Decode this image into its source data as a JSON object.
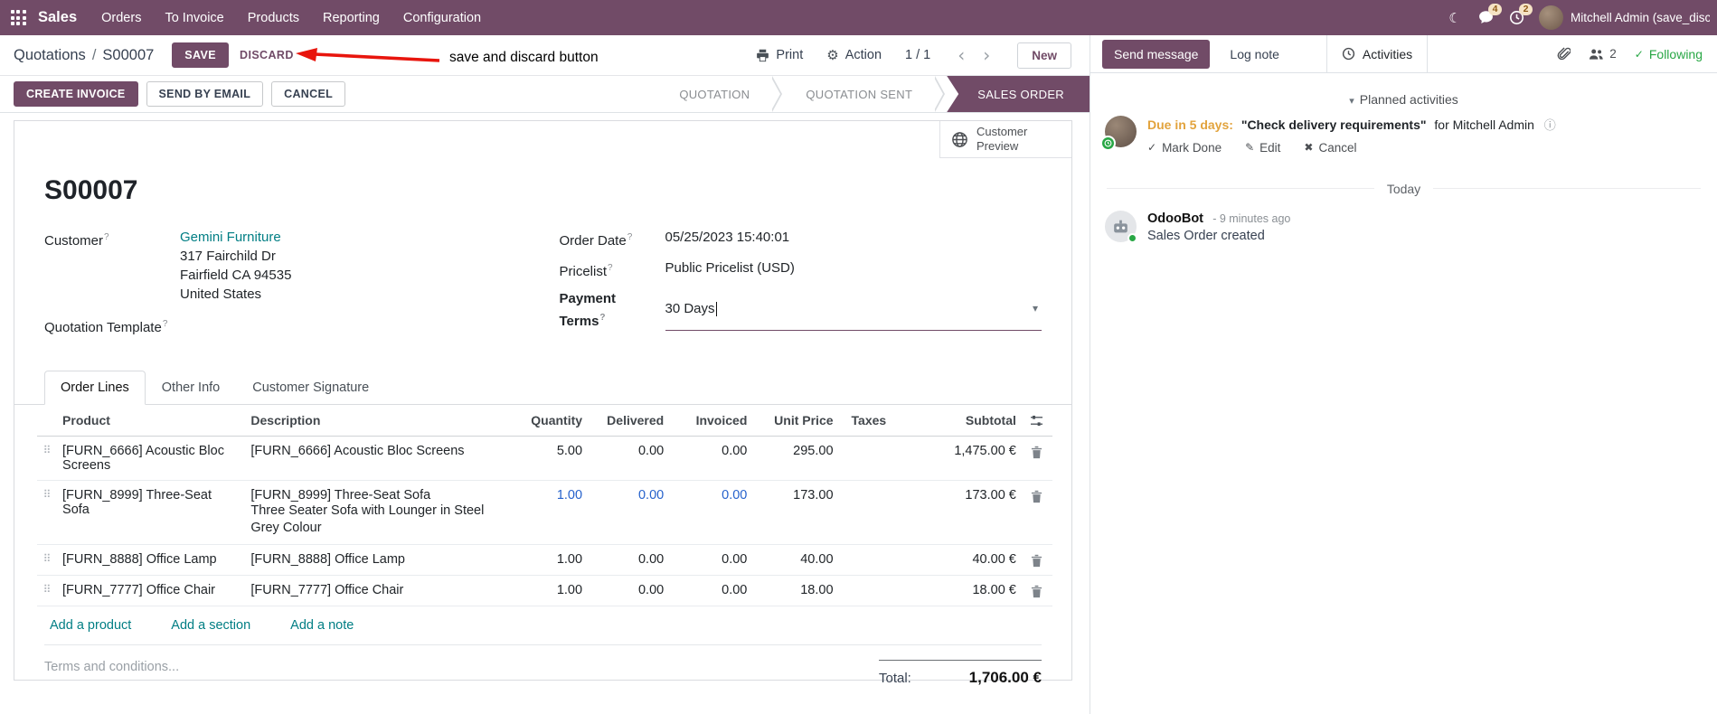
{
  "colors": {
    "primary": "#714B67",
    "link_teal": "#017e84",
    "highlight_blue": "#2662cc",
    "due_orange": "#e2a33d",
    "success_green": "#28a745",
    "annotation_red": "#e8150d"
  },
  "icons": {
    "moon": "☾",
    "gear": "⚙",
    "chevron_left": "‹",
    "chevron_right": "›",
    "dropdown_caret": "▾",
    "section_caret": "▾",
    "drag_handle": "⠿",
    "check": "✓",
    "pencil": "✎",
    "cross": "✖",
    "info": "ⓘ"
  },
  "nav": {
    "brand": "Sales",
    "menus": [
      "Orders",
      "To Invoice",
      "Products",
      "Reporting",
      "Configuration"
    ],
    "messages_badge": "4",
    "activities_badge": "2",
    "user_name": "Mitchell Admin (save_discar"
  },
  "breadcrumb": {
    "parent": "Quotations",
    "separator": "/",
    "current": "S00007",
    "save_label": "SAVE",
    "discard_label": "DISCARD"
  },
  "annotation": {
    "label": "save and discard button"
  },
  "control_panel": {
    "print_label": "Print",
    "action_label": "Action",
    "pager": "1 / 1",
    "new_label": "New"
  },
  "header_buttons": {
    "create_invoice": "CREATE INVOICE",
    "send_by_email": "SEND BY EMAIL",
    "cancel": "CANCEL"
  },
  "pipeline": {
    "steps": [
      {
        "label": "QUOTATION"
      },
      {
        "label": "QUOTATION SENT"
      },
      {
        "label": "SALES ORDER"
      }
    ]
  },
  "sheet": {
    "help_marker": "?",
    "smart_button": {
      "line1": "Customer",
      "line2": "Preview"
    },
    "title": "S00007",
    "customer": {
      "label": "Customer",
      "name": "Gemini Furniture",
      "address_line1": "317 Fairchild Dr",
      "address_line2": "Fairfield CA 94535",
      "address_line3": "United States"
    },
    "quotation_template": {
      "label": "Quotation Template"
    },
    "order_date": {
      "label": "Order Date",
      "value": "05/25/2023 15:40:01"
    },
    "pricelist": {
      "label": "Pricelist",
      "value": "Public Pricelist (USD)"
    },
    "payment_terms": {
      "label": "Payment Terms",
      "value": "30 Days"
    },
    "tabs": [
      {
        "label": "Order Lines"
      },
      {
        "label": "Other Info"
      },
      {
        "label": "Customer Signature"
      }
    ],
    "table": {
      "headers": {
        "product": "Product",
        "description": "Description",
        "quantity": "Quantity",
        "delivered": "Delivered",
        "invoiced": "Invoiced",
        "unit_price": "Unit Price",
        "taxes": "Taxes",
        "subtotal": "Subtotal"
      },
      "rows": [
        {
          "product": "[FURN_6666] Acoustic Bloc Screens",
          "description": "[FURN_6666] Acoustic Bloc Screens",
          "description2": "",
          "quantity": "5.00",
          "delivered": "0.00",
          "invoiced": "0.00",
          "unit_price": "295.00",
          "taxes": "",
          "subtotal": "1,475.00 €",
          "highlighted": false
        },
        {
          "product": "[FURN_8999] Three-Seat Sofa",
          "description": "[FURN_8999] Three-Seat Sofa",
          "description2": "Three Seater Sofa with Lounger in Steel Grey Colour",
          "quantity": "1.00",
          "delivered": "0.00",
          "invoiced": "0.00",
          "unit_price": "173.00",
          "taxes": "",
          "subtotal": "173.00 €",
          "highlighted": true
        },
        {
          "product": "[FURN_8888] Office Lamp",
          "description": "[FURN_8888] Office Lamp",
          "description2": "",
          "quantity": "1.00",
          "delivered": "0.00",
          "invoiced": "0.00",
          "unit_price": "40.00",
          "taxes": "",
          "subtotal": "40.00 €",
          "highlighted": false
        },
        {
          "product": "[FURN_7777] Office Chair",
          "description": "[FURN_7777] Office Chair",
          "description2": "",
          "quantity": "1.00",
          "delivered": "0.00",
          "invoiced": "0.00",
          "unit_price": "18.00",
          "taxes": "",
          "subtotal": "18.00 €",
          "highlighted": false
        }
      ],
      "add_product": "Add a product",
      "add_section": "Add a section",
      "add_note": "Add a note"
    },
    "terms_placeholder": "Terms and conditions...",
    "total": {
      "label": "Total:",
      "value": "1,706.00 €"
    }
  },
  "chatter": {
    "send_message": "Send message",
    "log_note": "Log note",
    "activities": "Activities",
    "followers_count": "2",
    "following": "Following",
    "planned_header": "Planned activities",
    "activity": {
      "due": "Due in 5 days:",
      "summary": "\"Check delivery requirements\"",
      "assignee": "for Mitchell Admin",
      "mark_done": "Mark Done",
      "edit": "Edit",
      "cancel": "Cancel"
    },
    "divider": "Today",
    "message": {
      "author": "OdooBot",
      "time": "- 9 minutes ago",
      "body": "Sales Order created"
    }
  }
}
